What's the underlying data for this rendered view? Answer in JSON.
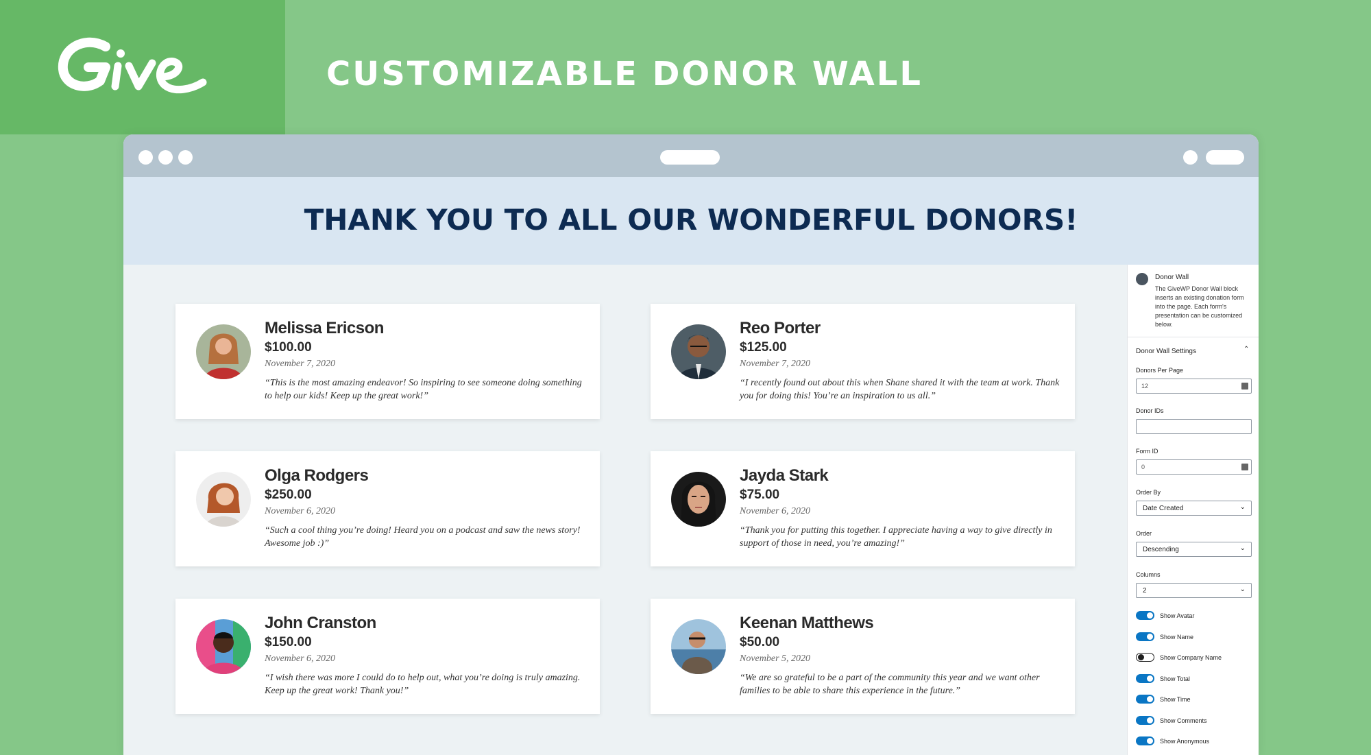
{
  "header": {
    "logo_text": "Give",
    "title": "CUSTOMIZABLE DONOR WALL"
  },
  "page": {
    "banner_title": "THANK YOU TO ALL OUR WONDERFUL DONORS!"
  },
  "donors": [
    {
      "name": "Melissa Ericson",
      "amount": "$100.00",
      "date": "November 7, 2020",
      "comment": "“This is the most amazing endeavor! So inspiring to see someone doing something to help our kids! Keep up the great work!”"
    },
    {
      "name": "Reo Porter",
      "amount": "$125.00",
      "date": "November 7, 2020",
      "comment": "“I recently found out about this when Shane shared it with the team at work. Thank you for doing this! You’re an inspiration to us all.”"
    },
    {
      "name": "Olga Rodgers",
      "amount": "$250.00",
      "date": "November 6, 2020",
      "comment": "“Such a cool thing you’re doing! Heard you on a podcast and saw the news story! Awesome job :)”"
    },
    {
      "name": "Jayda Stark",
      "amount": "$75.00",
      "date": "November 6, 2020",
      "comment": "“Thank you for putting this together. I appreciate having a way to give directly in support of those in need, you’re amazing!”"
    },
    {
      "name": "John Cranston",
      "amount": "$150.00",
      "date": "November 6, 2020",
      "comment": "“I wish there was more I could do to help out, what you’re doing is truly amazing. Keep up the great work! Thank you!”"
    },
    {
      "name": "Keenan Matthews",
      "amount": "$50.00",
      "date": "November 5, 2020",
      "comment": "“We are so grateful to be a part of the community this year and we want other families to be able to share this experience in the future.”"
    }
  ],
  "sidebar": {
    "block_title": "Donor Wall",
    "block_description": "The GiveWP Donor Wall block inserts an existing donation form into the page. Each form's presentation can be customized below.",
    "panel_title": "Donor Wall Settings",
    "donors_per_page_label": "Donors Per Page",
    "donors_per_page_value": "12",
    "donor_ids_label": "Donor IDs",
    "donor_ids_value": "",
    "form_id_label": "Form ID",
    "form_id_value": "0",
    "order_by_label": "Order By",
    "order_by_value": "Date Created",
    "order_label": "Order",
    "order_value": "Descending",
    "columns_label": "Columns",
    "columns_value": "2",
    "toggles": [
      {
        "label": "Show Avatar",
        "on": true
      },
      {
        "label": "Show Name",
        "on": true
      },
      {
        "label": "Show Company Name",
        "on": false
      },
      {
        "label": "Show Total",
        "on": true
      },
      {
        "label": "Show Time",
        "on": true
      },
      {
        "label": "Show Comments",
        "on": true
      },
      {
        "label": "Show Anonymous",
        "on": true
      }
    ]
  },
  "colors": {
    "background": "#85c788",
    "logo_panel": "#66b866",
    "banner": "#d9e6f2",
    "banner_text": "#0d2b52",
    "toggle_on": "#0a76c4"
  }
}
